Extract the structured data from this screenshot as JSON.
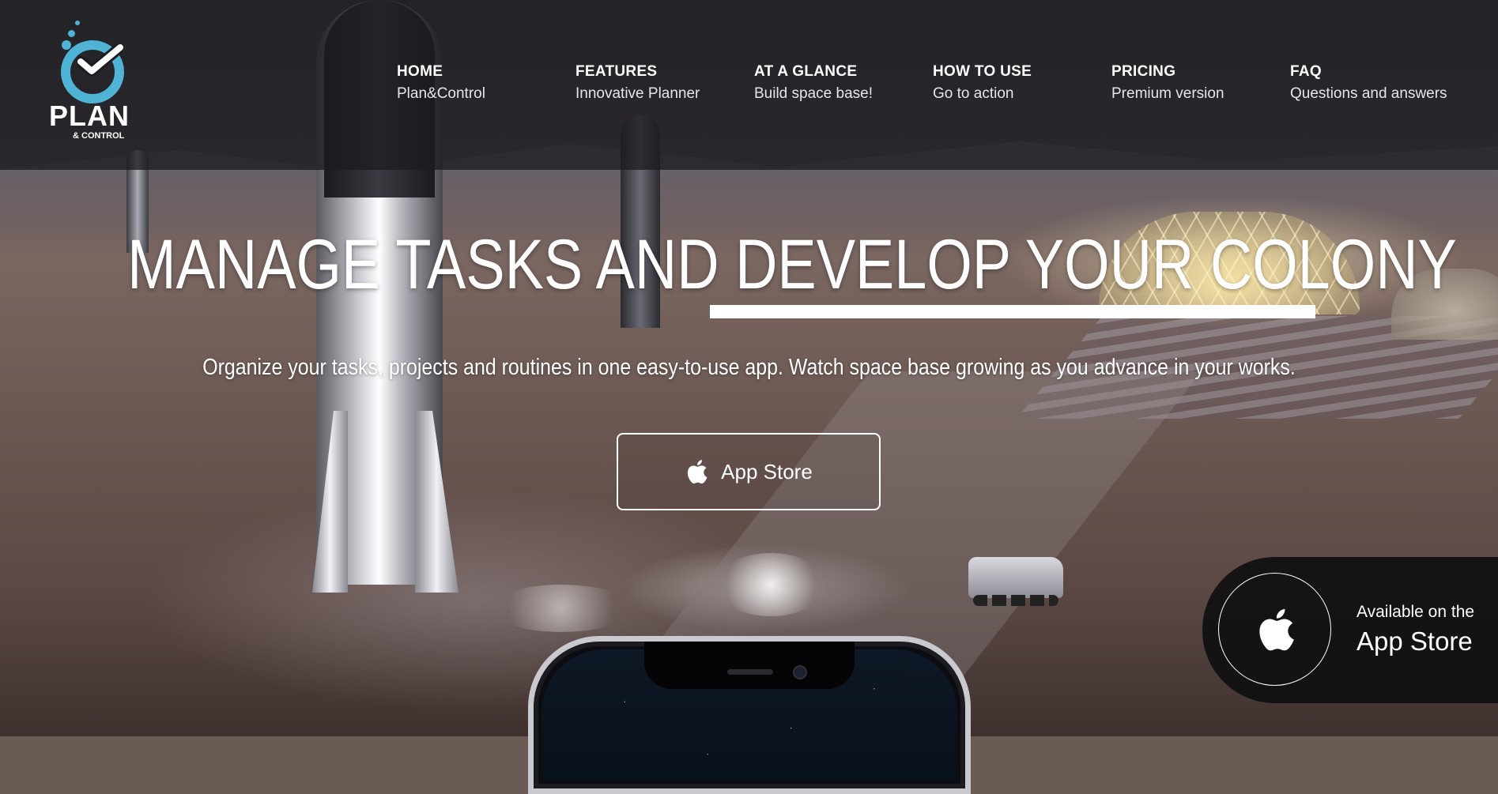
{
  "logo": {
    "word": "PLAN",
    "sub": "& CONTROL",
    "icon": "check-circle-icon",
    "color": "#4fb3d6"
  },
  "nav": [
    {
      "title": "HOME",
      "subtitle": "Plan&Control"
    },
    {
      "title": "FEATURES",
      "subtitle": "Innovative Planner"
    },
    {
      "title": "AT A GLANCE",
      "subtitle": "Build space base!"
    },
    {
      "title": "HOW TO USE",
      "subtitle": "Go to action"
    },
    {
      "title": "PRICING",
      "subtitle": "Premium version"
    },
    {
      "title": "FAQ",
      "subtitle": "Questions and answers"
    }
  ],
  "hero": {
    "title": "MANAGE TASKS AND DEVELOP YOUR COLONY",
    "subtitle": "Organize your tasks, projects and routines in one easy-to-use app. Watch space base growing as you advance in your works.",
    "button_label": "App Store",
    "button_icon": "apple-icon"
  },
  "badge": {
    "line1": "Available on the",
    "line2": "App Store",
    "icon": "apple-icon"
  },
  "colors": {
    "header_bg": "rgba(28,28,32,0.78)",
    "accent": "#4fb3d6",
    "text": "#ffffff"
  }
}
